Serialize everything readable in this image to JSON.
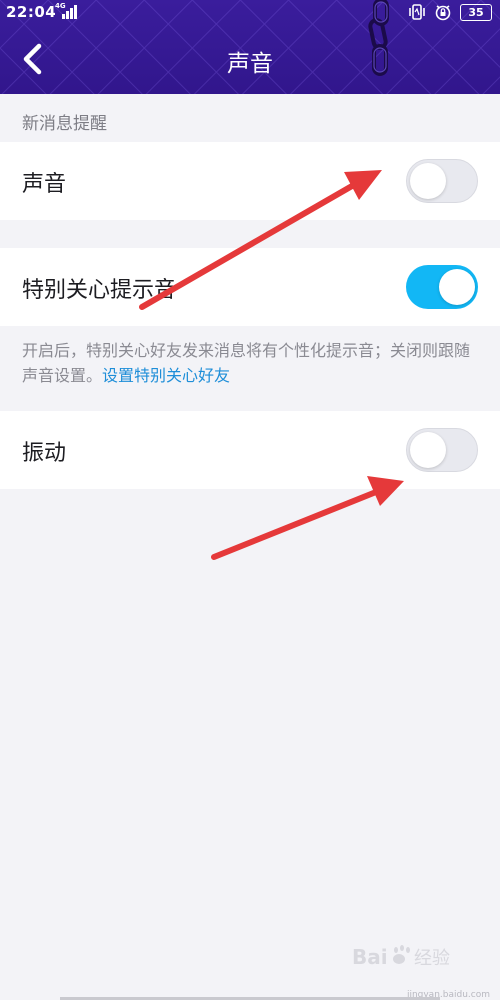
{
  "status_bar": {
    "time": "22:04",
    "network_label": "4G",
    "battery": "35",
    "icons": [
      "signal-icon",
      "vibrate-icon",
      "alarm-lock-icon"
    ]
  },
  "nav": {
    "title": "声音",
    "back_icon": "chevron-left-icon"
  },
  "section": {
    "title": "新消息提醒"
  },
  "settings": [
    {
      "label": "声音",
      "enabled": false
    },
    {
      "label": "特别关心提示音",
      "enabled": true
    },
    {
      "label": "振动",
      "enabled": false
    }
  ],
  "note": {
    "text": "开启后，特别关心好友发来消息将有个性化提示音；关闭则跟随声音设置。",
    "link": "设置特别关心好友"
  },
  "watermark": {
    "url": "jingyan.baidu.com"
  },
  "colors": {
    "header": "#3a1d9c",
    "toggle_on": "#12b7f5",
    "toggle_off": "#e8e9ef",
    "link": "#1e8ed8",
    "annotation_arrow": "#e5393a"
  }
}
